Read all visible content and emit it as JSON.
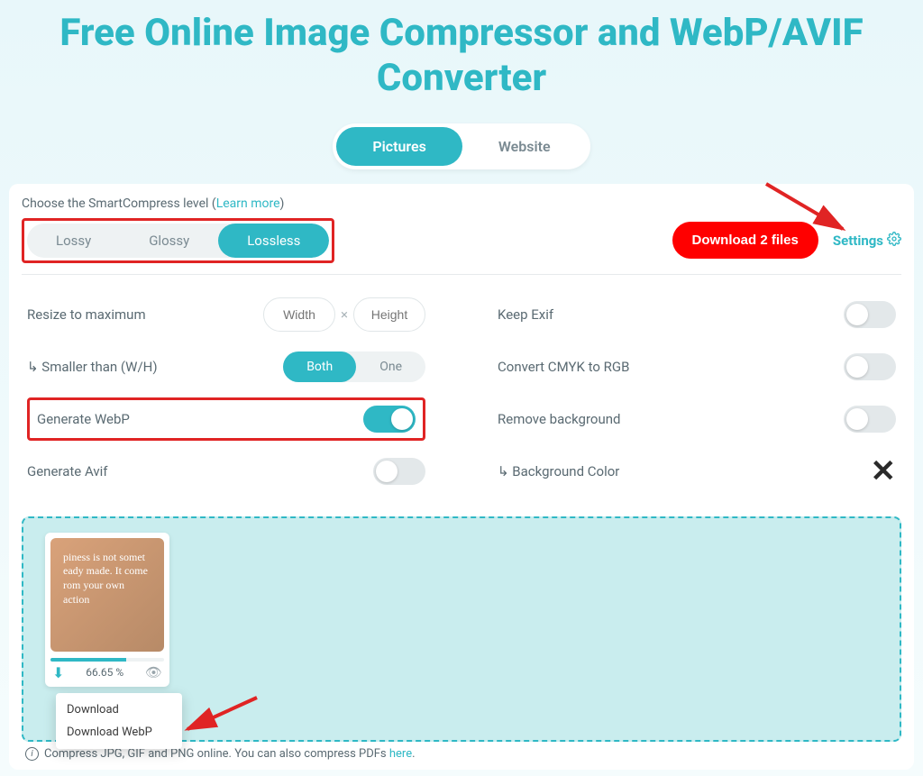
{
  "title": "Free Online Image Compressor and WebP/AVIF Converter",
  "tabs": {
    "pictures": "Pictures",
    "website": "Website"
  },
  "top_line_prefix": "Choose the SmartCompress level (",
  "top_line_link": "Learn more",
  "top_line_suffix": ")",
  "compression_levels": {
    "lossy": "Lossy",
    "glossy": "Glossy",
    "lossless": "Lossless"
  },
  "download_button": "Download 2 files",
  "settings_label": "Settings",
  "options": {
    "resize_label": "Resize to maximum",
    "width_ph": "Width",
    "height_ph": "Height",
    "smaller_label": "↳ Smaller than (W/H)",
    "both": "Both",
    "one": "One",
    "generate_webp": "Generate WebP",
    "generate_avif": "Generate Avif",
    "keep_exif": "Keep Exif",
    "convert_cmyk": "Convert CMYK to RGB",
    "remove_bg": "Remove background",
    "bg_color": "↳ Background Color"
  },
  "thumb": {
    "quote": "piness is not somet eady made. It come rom your own action",
    "percent": "66.65 %"
  },
  "menu": {
    "download": "Download",
    "download_webp": "Download WebP"
  },
  "footer": {
    "text_before": "Compress JPG, GIF and PNG online. You can also compress PDFs ",
    "link": "here",
    "text_after": "."
  }
}
